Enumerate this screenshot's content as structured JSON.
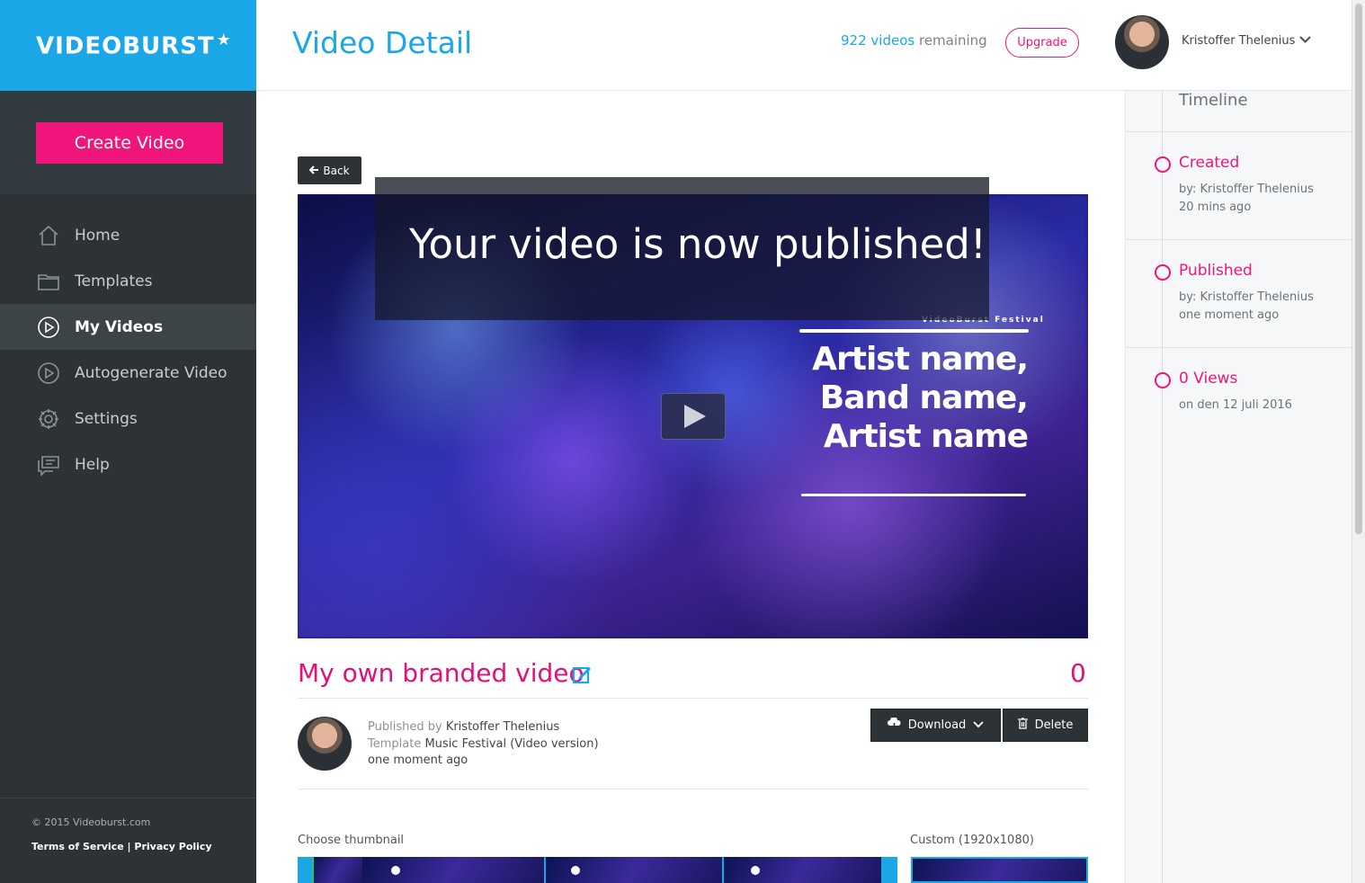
{
  "app": {
    "logo_text": "VIDEOBURST",
    "logo_star": "★"
  },
  "sidebar": {
    "create_label": "Create Video",
    "items": [
      {
        "label": "Home",
        "icon": "home-icon"
      },
      {
        "label": "Templates",
        "icon": "folder-icon"
      },
      {
        "label": "My Videos",
        "icon": "play-circle-icon",
        "active": true
      },
      {
        "label": "Autogenerate Video",
        "icon": "play-circle-icon"
      },
      {
        "label": "Settings",
        "icon": "gear-icon"
      },
      {
        "label": "Help",
        "icon": "help-chat-icon"
      }
    ],
    "footer": {
      "copyright": "© 2015 Videoburst.com",
      "terms": "Terms of Service",
      "separator": "|",
      "privacy": "Privacy Policy"
    }
  },
  "header": {
    "title": "Video Detail",
    "remaining_count": "922 videos",
    "remaining_suffix": "remaining",
    "upgrade_label": "Upgrade",
    "user_name": "Kristoffer Thelenius"
  },
  "main": {
    "back_label": "Back",
    "banner_text": "Your video is now published!",
    "video_overlay": {
      "festival": "VideoBurst Festival",
      "lines": [
        "Artist name,",
        "Band name,",
        "Artist name"
      ]
    },
    "video_title": "My own branded video",
    "view_count": "0",
    "published": {
      "by_prefix": "Published by",
      "by_name": "Kristoffer Thelenius",
      "template_prefix": "Template",
      "template_name": "Music Festival (Video version)",
      "time": "one moment ago"
    },
    "download_label": "Download",
    "delete_label": "Delete",
    "choose_thumbnail_label": "Choose thumbnail",
    "custom_label": "Custom (1920x1080)"
  },
  "timeline": {
    "title": "Timeline",
    "events": [
      {
        "head": "Created",
        "line1": "by: Kristoffer Thelenius",
        "line2": "20 mins ago"
      },
      {
        "head": "Published",
        "line1": "by: Kristoffer Thelenius",
        "line2": "one moment ago"
      },
      {
        "head": "0 Views",
        "line1": "on den 12 juli 2016",
        "line2": ""
      }
    ]
  },
  "colors": {
    "brand_blue": "#1aa7e8",
    "accent_pink": "#f0157a",
    "sidebar_dark": "#2c3236"
  }
}
